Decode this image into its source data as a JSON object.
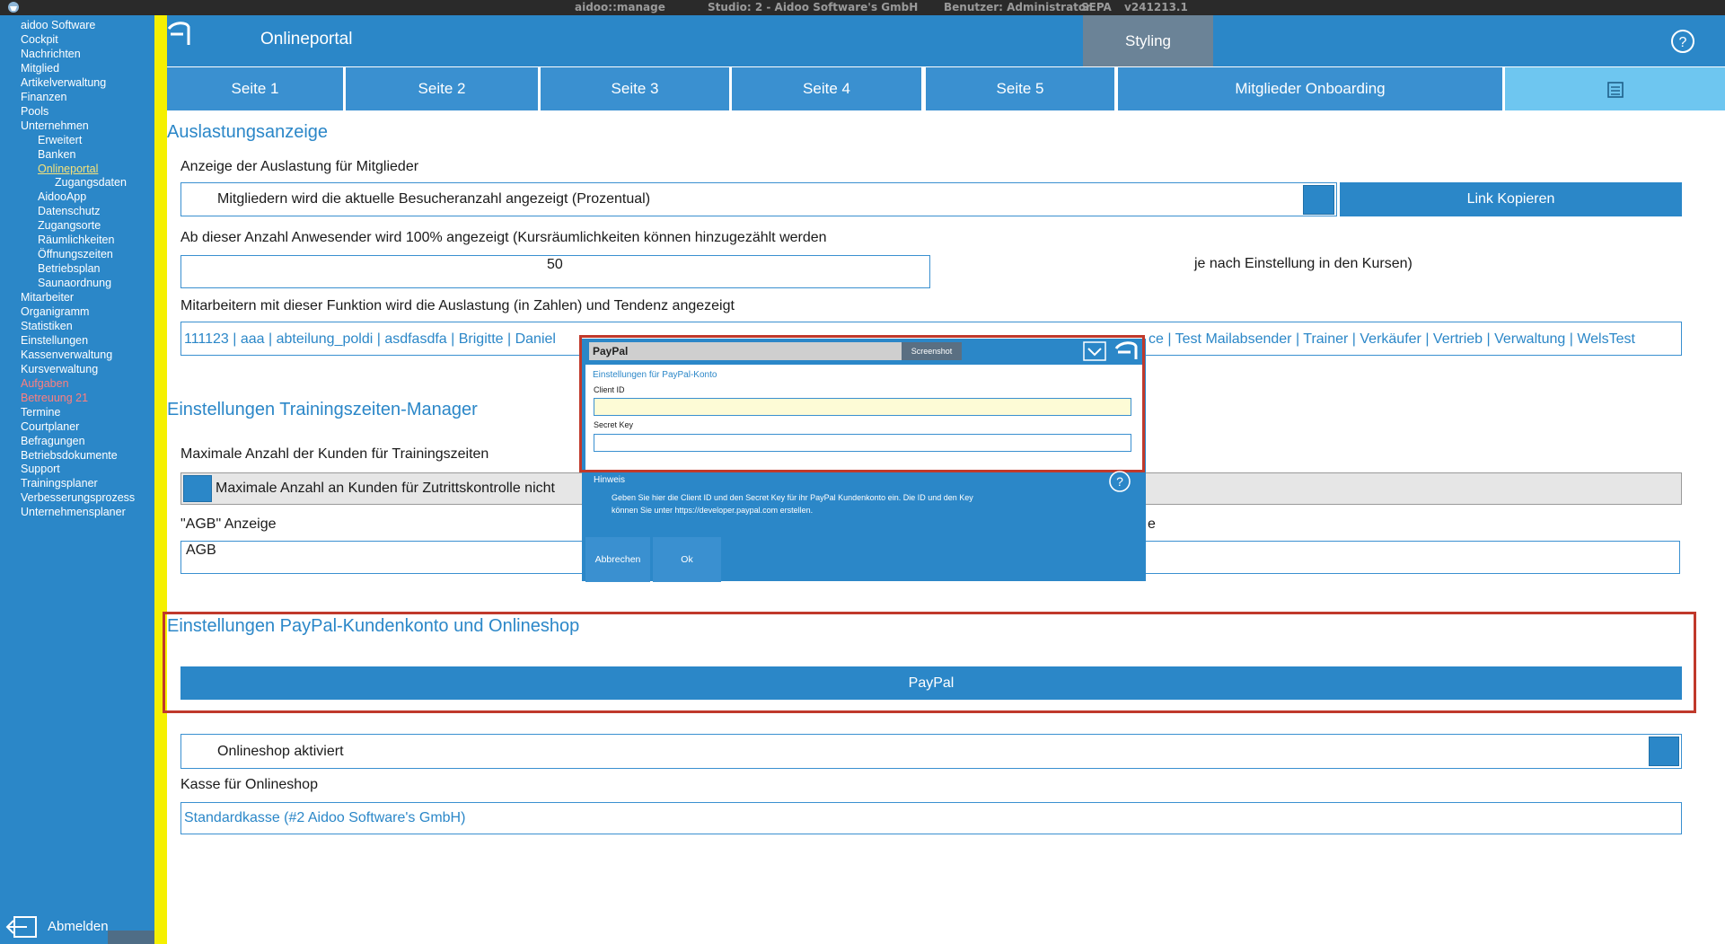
{
  "titlebar": {
    "app": "aidoo::manage",
    "studio": "Studio: 2 - Aidoo Software's GmbH",
    "user": "Benutzer: Administrator",
    "sepa": "SEPA",
    "version": "v241213.1"
  },
  "sidebar": {
    "items": [
      {
        "label": "aidoo Software",
        "level": 0
      },
      {
        "label": "Cockpit",
        "level": 0
      },
      {
        "label": "Nachrichten",
        "level": 0
      },
      {
        "label": "Mitglied",
        "level": 0
      },
      {
        "label": "Artikelverwaltung",
        "level": 0
      },
      {
        "label": "Finanzen",
        "level": 0
      },
      {
        "label": "Pools",
        "level": 0
      },
      {
        "label": "Unternehmen",
        "level": 0
      },
      {
        "label": "Erweitert",
        "level": 1
      },
      {
        "label": "Banken",
        "level": 1
      },
      {
        "label": "Onlineportal",
        "level": 1,
        "active": true
      },
      {
        "label": "Zugangsdaten",
        "level": 2
      },
      {
        "label": "AidooApp",
        "level": 1
      },
      {
        "label": "Datenschutz",
        "level": 1
      },
      {
        "label": "Zugangsorte",
        "level": 1
      },
      {
        "label": "Räumlichkeiten",
        "level": 1
      },
      {
        "label": "Öffnungszeiten",
        "level": 1
      },
      {
        "label": "Betriebsplan",
        "level": 1
      },
      {
        "label": "Saunaordnung",
        "level": 1
      },
      {
        "label": "Mitarbeiter",
        "level": 0
      },
      {
        "label": "Organigramm",
        "level": 0
      },
      {
        "label": "Statistiken",
        "level": 0
      },
      {
        "label": "Einstellungen",
        "level": 0
      },
      {
        "label": "Kassenverwaltung",
        "level": 0
      },
      {
        "label": "Kursverwaltung",
        "level": 0
      },
      {
        "label": "Aufgaben",
        "level": 0,
        "red": true
      },
      {
        "label": "Betreuung 21",
        "level": 0,
        "red": true
      },
      {
        "label": "Termine",
        "level": 0
      },
      {
        "label": "Courtplaner",
        "level": 0
      },
      {
        "label": "Befragungen",
        "level": 0
      },
      {
        "label": "Betriebsdokumente",
        "level": 0
      },
      {
        "label": "Support",
        "level": 0
      },
      {
        "label": "Trainingsplaner",
        "level": 0
      },
      {
        "label": "Verbesserungsprozess",
        "level": 0
      },
      {
        "label": "Unternehmensplaner",
        "level": 0
      }
    ],
    "logout_label": "Abmelden"
  },
  "header": {
    "title": "Onlineportal",
    "styling_tab": "Styling"
  },
  "tabs": [
    "Seite 1",
    "Seite 2",
    "Seite 3",
    "Seite 4",
    "Seite 5",
    "Mitglieder Onboarding"
  ],
  "auslastung": {
    "title": "Auslastungsanzeige",
    "label1": "Anzeige der Auslastung für Mitglieder",
    "option_text": "Mitgliedern wird die aktuelle Besucheranzahl angezeigt (Prozentual)",
    "link_button": "Link Kopieren",
    "label2": "Ab dieser Anzahl Anwesender wird 100% angezeigt (Kursräumlichkeiten können hinzugezählt werden",
    "count_value": "50",
    "count_suffix": "je nach Einstellung in den Kursen)",
    "label3": "Mitarbeitern mit dieser Funktion wird die Auslastung (in Zahlen) und Tendenz angezeigt",
    "functions_left": "111123 | aaa | abteilung_poldi | asdfasdfa | Brigitte | Daniel",
    "functions_right": "ce | Test Mailabsender | Trainer | Verkäufer | Vertrieb | Verwaltung | WelsTest"
  },
  "training": {
    "title": "Einstellungen Trainingszeiten-Manager",
    "label": "Maximale Anzahl der Kunden für Trainingszeiten",
    "option_text": "Maximale Anzahl an Kunden für Zutrittskontrolle nicht",
    "agb_label": "\"AGB\" Anzeige",
    "agb_value": "AGB",
    "agb_right_fragment": "e"
  },
  "paypal_section": {
    "title": "Einstellungen PayPal-Kundenkonto und Onlineshop",
    "button": "PayPal"
  },
  "onlineshop": {
    "option_text": "Onlineshop aktiviert",
    "kasse_label": "Kasse für Onlineshop",
    "kasse_value": "Standardkasse (#2 Aidoo Software's GmbH)"
  },
  "dialog": {
    "title": "PayPal",
    "screenshot_button": "Screenshot",
    "heading": "Einstellungen für PayPal-Konto",
    "client_id_label": "Client ID",
    "client_id_value": "",
    "secret_key_label": "Secret Key",
    "secret_key_value": "",
    "hint_title": "Hinweis",
    "hint_text": "Geben Sie hier die Client ID und den Secret Key für ihr PayPal Kundenkonto ein. Die ID und den Key können Sie unter https://developer.paypal.com erstellen.",
    "cancel_button": "Abbrechen",
    "ok_button": "Ok"
  },
  "colors": {
    "primary": "#2b87c8",
    "accent_yellow": "#f5f000",
    "highlight_red": "#c0392b",
    "styling_tab": "#6b8397"
  }
}
